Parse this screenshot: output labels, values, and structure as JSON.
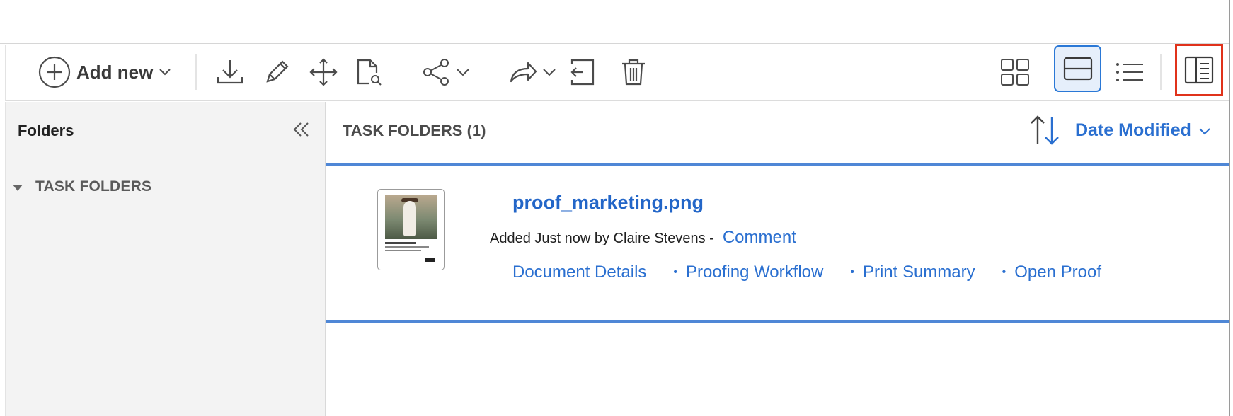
{
  "toolbar": {
    "add_new_label": "Add new",
    "icons": [
      "add-circle-icon",
      "chevron-down-icon",
      "download-icon",
      "pencil-icon",
      "move-icon",
      "search-document-icon",
      "share-icon",
      "forward-icon",
      "checkin-icon",
      "trash-icon",
      "grid-view-icon",
      "card-view-icon",
      "list-view-icon",
      "toggle-panel-icon"
    ],
    "active_view": "card-view",
    "highlight_color": "#e0321b"
  },
  "sidebar": {
    "title": "Folders",
    "tree": [
      {
        "label": "TASK FOLDERS",
        "expanded": true
      }
    ]
  },
  "main": {
    "title": "TASK FOLDERS (1)",
    "sort": {
      "label": "Date Modified"
    },
    "items": [
      {
        "filename": "proof_marketing.png",
        "added_text": "Added Just now by Claire Stevens -",
        "comment_label": "Comment",
        "links": [
          "Document Details",
          "Proofing Workflow",
          "Print Summary",
          "Open Proof"
        ]
      }
    ]
  },
  "colors": {
    "accent": "#2a6fd0",
    "divider": "#4f87d6",
    "sidebar_bg": "#f3f3f3"
  }
}
